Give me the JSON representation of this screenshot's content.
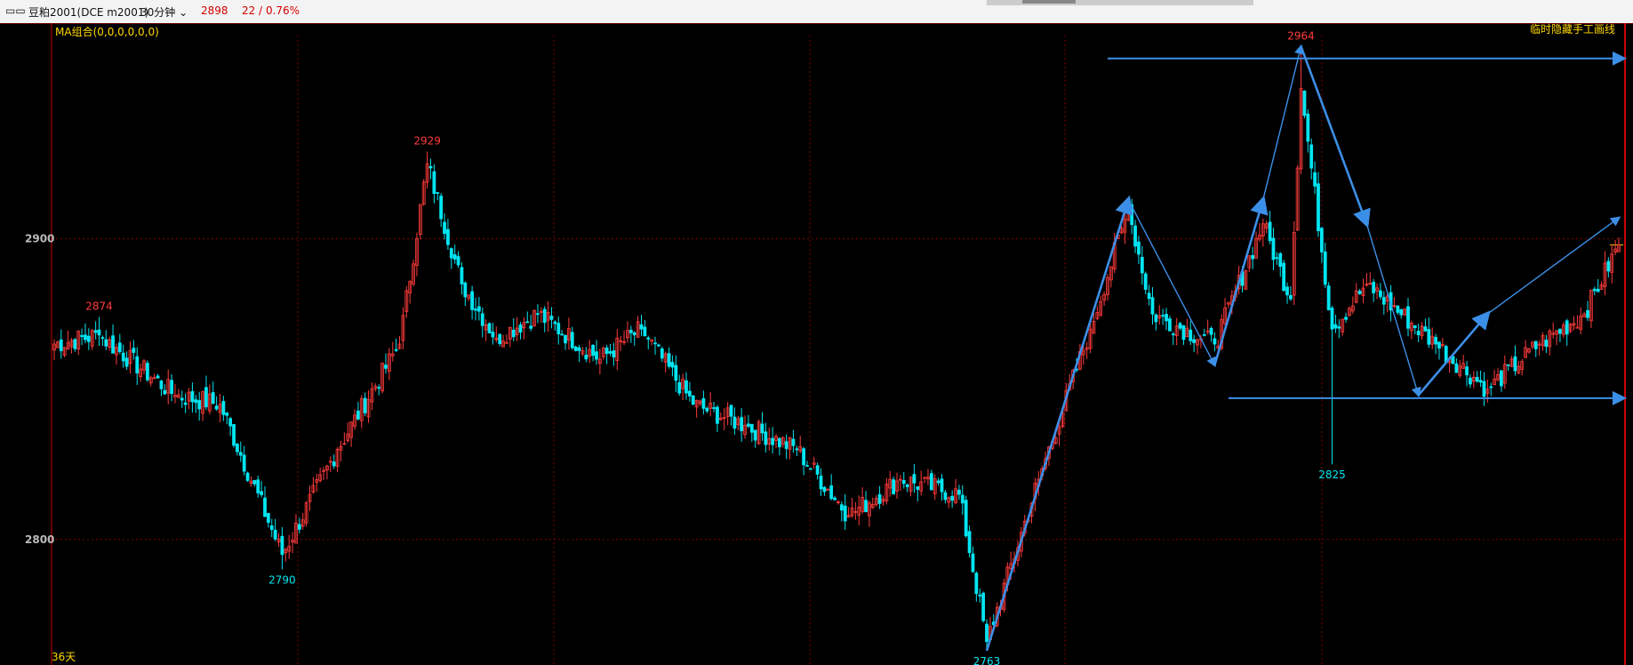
{
  "header": {
    "icon": "window-icon",
    "instrument": "豆粕2001(DCE m2001)",
    "period": "30分钟",
    "price": "2898",
    "change": "22 / 0.76%"
  },
  "indicator_label": "MA组合(0,0,0,0,0,0)",
  "overlay_label": "临时隐藏手工画线",
  "footer_label": "36天",
  "colors": {
    "up": "#ff3b3b",
    "down": "#00e5f2",
    "grid": "#7a0000",
    "drawing": "#3c8fe6",
    "label": "#ffd700"
  },
  "chart_data": {
    "type": "candlestick",
    "ylim": [
      2760,
      2970
    ],
    "y_ticks": [
      2800,
      2900
    ],
    "grid": true,
    "peaks_troughs": [
      {
        "label": "2874",
        "value": 2874,
        "kind": "high",
        "bar": 13
      },
      {
        "label": "2929",
        "value": 2929,
        "kind": "high",
        "bar": 108
      },
      {
        "label": "2790",
        "value": 2790,
        "kind": "low",
        "bar": 66
      },
      {
        "label": "2763",
        "value": 2763,
        "kind": "low",
        "bar": 270
      },
      {
        "label": "2964",
        "value": 2964,
        "kind": "high",
        "bar": 361
      },
      {
        "label": "2825",
        "value": 2825,
        "kind": "low",
        "bar": 370
      }
    ],
    "anchors": [
      {
        "bar": 0,
        "close": 2865
      },
      {
        "bar": 13,
        "close": 2868
      },
      {
        "bar": 35,
        "close": 2848
      },
      {
        "bar": 48,
        "close": 2845
      },
      {
        "bar": 66,
        "close": 2795
      },
      {
        "bar": 82,
        "close": 2830
      },
      {
        "bar": 100,
        "close": 2865
      },
      {
        "bar": 108,
        "close": 2925
      },
      {
        "bar": 118,
        "close": 2885
      },
      {
        "bar": 128,
        "close": 2867
      },
      {
        "bar": 140,
        "close": 2875
      },
      {
        "bar": 158,
        "close": 2860
      },
      {
        "bar": 170,
        "close": 2870
      },
      {
        "bar": 185,
        "close": 2845
      },
      {
        "bar": 200,
        "close": 2838
      },
      {
        "bar": 215,
        "close": 2830
      },
      {
        "bar": 230,
        "close": 2808
      },
      {
        "bar": 245,
        "close": 2820
      },
      {
        "bar": 262,
        "close": 2815
      },
      {
        "bar": 270,
        "close": 2766
      },
      {
        "bar": 285,
        "close": 2820
      },
      {
        "bar": 300,
        "close": 2870
      },
      {
        "bar": 311,
        "close": 2910
      },
      {
        "bar": 318,
        "close": 2875
      },
      {
        "bar": 336,
        "close": 2865
      },
      {
        "bar": 350,
        "close": 2905
      },
      {
        "bar": 358,
        "close": 2880
      },
      {
        "bar": 361,
        "close": 2950
      },
      {
        "bar": 370,
        "close": 2870
      },
      {
        "bar": 380,
        "close": 2885
      },
      {
        "bar": 400,
        "close": 2865
      },
      {
        "bar": 415,
        "close": 2850
      },
      {
        "bar": 430,
        "close": 2865
      },
      {
        "bar": 443,
        "close": 2875
      },
      {
        "bar": 453,
        "close": 2898
      }
    ],
    "bar_count": 454,
    "drawings": [
      {
        "type": "hline",
        "value": 2960,
        "from_bar": 305
      },
      {
        "type": "hline",
        "value": 2847,
        "from_bar": 340
      },
      {
        "type": "polyline",
        "points": [
          [
            270,
            2763
          ],
          [
            311,
            2913
          ],
          [
            336,
            2858
          ],
          [
            350,
            2913
          ],
          [
            361,
            2964
          ],
          [
            380,
            2905
          ],
          [
            395,
            2848
          ],
          [
            415,
            2875
          ],
          [
            453,
            2907
          ]
        ]
      }
    ]
  }
}
